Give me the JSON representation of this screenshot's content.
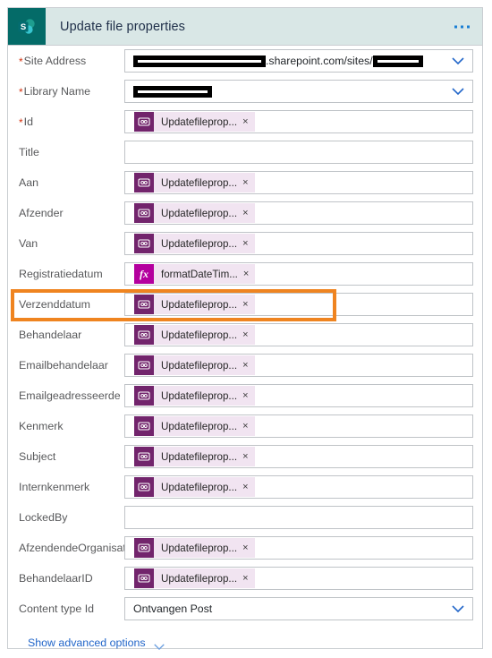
{
  "header": {
    "title": "Update file properties",
    "logo_icon": "sharepoint-icon",
    "menu_icon": "ellipsis-menu-icon",
    "bg_color": "#d9e7e6",
    "logo_bg_color": "#046b68"
  },
  "colors": {
    "accent_blue": "#2266c9",
    "required_star": "#d5320f",
    "highlight_orange": "#ef8420",
    "chip_bg": "#f1e4f1",
    "chip_icon_bg": "#72246c",
    "chip_fx_bg": "#b4009e"
  },
  "site_address": {
    "label": "Site Address",
    "required": true,
    "redacted_prefix": true,
    "visible_text": ".sharepoint.com/sites/",
    "redacted_suffix": true,
    "chevron_icon": "chevron-down-icon"
  },
  "library_name": {
    "label": "Library Name",
    "required": true,
    "redacted": true,
    "chevron_icon": "chevron-down-icon"
  },
  "content_type": {
    "label": "Content type Id",
    "value": "Ontvangen Post",
    "chevron_icon": "chevron-down-icon"
  },
  "chip": {
    "token_label": "Updatefileprop...",
    "function_label": "formatDateTim...",
    "close_glyph": "×",
    "token_icon": "dynamic-content-token-icon",
    "function_icon": "fx-expression-icon",
    "fx_label": "fx"
  },
  "fields": [
    {
      "label": "Id",
      "required": true,
      "type": "token"
    },
    {
      "label": "Title",
      "required": false,
      "type": "empty"
    },
    {
      "label": "Aan",
      "required": false,
      "type": "token"
    },
    {
      "label": "Afzender",
      "required": false,
      "type": "token"
    },
    {
      "label": "Van",
      "required": false,
      "type": "token"
    },
    {
      "label": "Registratiedatum",
      "required": false,
      "type": "function"
    },
    {
      "label": "Verzenddatum",
      "required": false,
      "type": "token",
      "highlighted": true
    },
    {
      "label": "Behandelaar",
      "required": false,
      "type": "token"
    },
    {
      "label": "Emailbehandelaar",
      "required": false,
      "type": "token"
    },
    {
      "label": "Emailgeadresseerde",
      "required": false,
      "type": "token"
    },
    {
      "label": "Kenmerk",
      "required": false,
      "type": "token"
    },
    {
      "label": "Subject",
      "required": false,
      "type": "token"
    },
    {
      "label": "Internkenmerk",
      "required": false,
      "type": "token"
    },
    {
      "label": "LockedBy",
      "required": false,
      "type": "empty"
    },
    {
      "label": "AfzendendeOrganisatie",
      "required": false,
      "type": "token"
    },
    {
      "label": "BehandelaarID",
      "required": false,
      "type": "token"
    }
  ],
  "footer": {
    "advanced_label": "Show advanced options",
    "advanced_icon": "chevron-down-icon"
  }
}
